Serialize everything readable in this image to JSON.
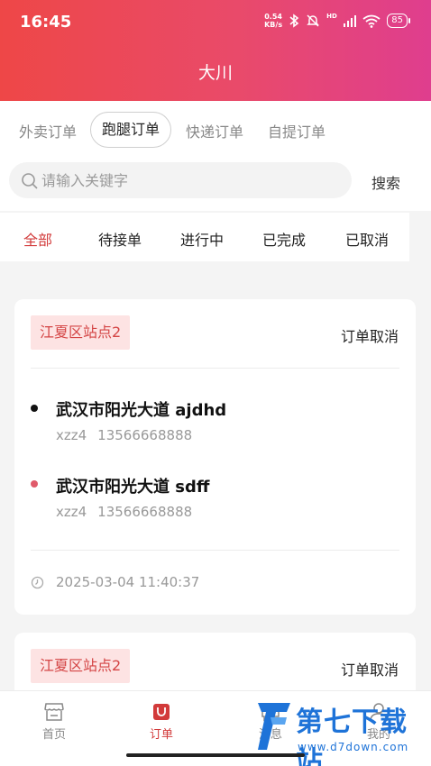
{
  "status_bar": {
    "time": "16:45",
    "net_speed_value": "0.54",
    "net_speed_unit": "KB/s",
    "signal_label": "HD",
    "battery": "85"
  },
  "header": {
    "title": "大川"
  },
  "category_tabs": [
    {
      "label": "外卖订单",
      "active": false
    },
    {
      "label": "跑腿订单",
      "active": true
    },
    {
      "label": "快递订单",
      "active": false
    },
    {
      "label": "自提订单",
      "active": false
    }
  ],
  "search": {
    "placeholder": "请输入关键字",
    "button_label": "搜索"
  },
  "status_tabs": [
    {
      "label": "全部",
      "active": true
    },
    {
      "label": "待接单",
      "active": false
    },
    {
      "label": "进行中",
      "active": false
    },
    {
      "label": "已完成",
      "active": false
    },
    {
      "label": "已取消",
      "active": false
    }
  ],
  "orders": [
    {
      "station": "江夏区站点2",
      "action": "订单取消",
      "pickup": {
        "address": "武汉市阳光大道 ajdhd",
        "name": "xzz4",
        "phone": "13566668888"
      },
      "delivery": {
        "address": "武汉市阳光大道 sdff",
        "name": "xzz4",
        "phone": "13566668888"
      },
      "time": "2025-03-04 11:40:37"
    },
    {
      "station": "江夏区站点2",
      "action": "订单取消"
    }
  ],
  "bottom_nav": [
    {
      "label": "首页",
      "icon": "store-icon",
      "active": false
    },
    {
      "label": "订单",
      "icon": "order-bag-icon",
      "active": true
    },
    {
      "label": "消息",
      "icon": "message-icon",
      "active": false
    },
    {
      "label": "我的",
      "icon": "user-icon",
      "active": false
    }
  ],
  "watermark": {
    "name": "第七下载站",
    "url": "www.d7down.com"
  },
  "colors": {
    "accent": "#d23a3a",
    "header_start": "#ee4747",
    "header_end": "#df3e8e",
    "station_bg": "#fde3e3",
    "watermark": "#1e73d8"
  }
}
